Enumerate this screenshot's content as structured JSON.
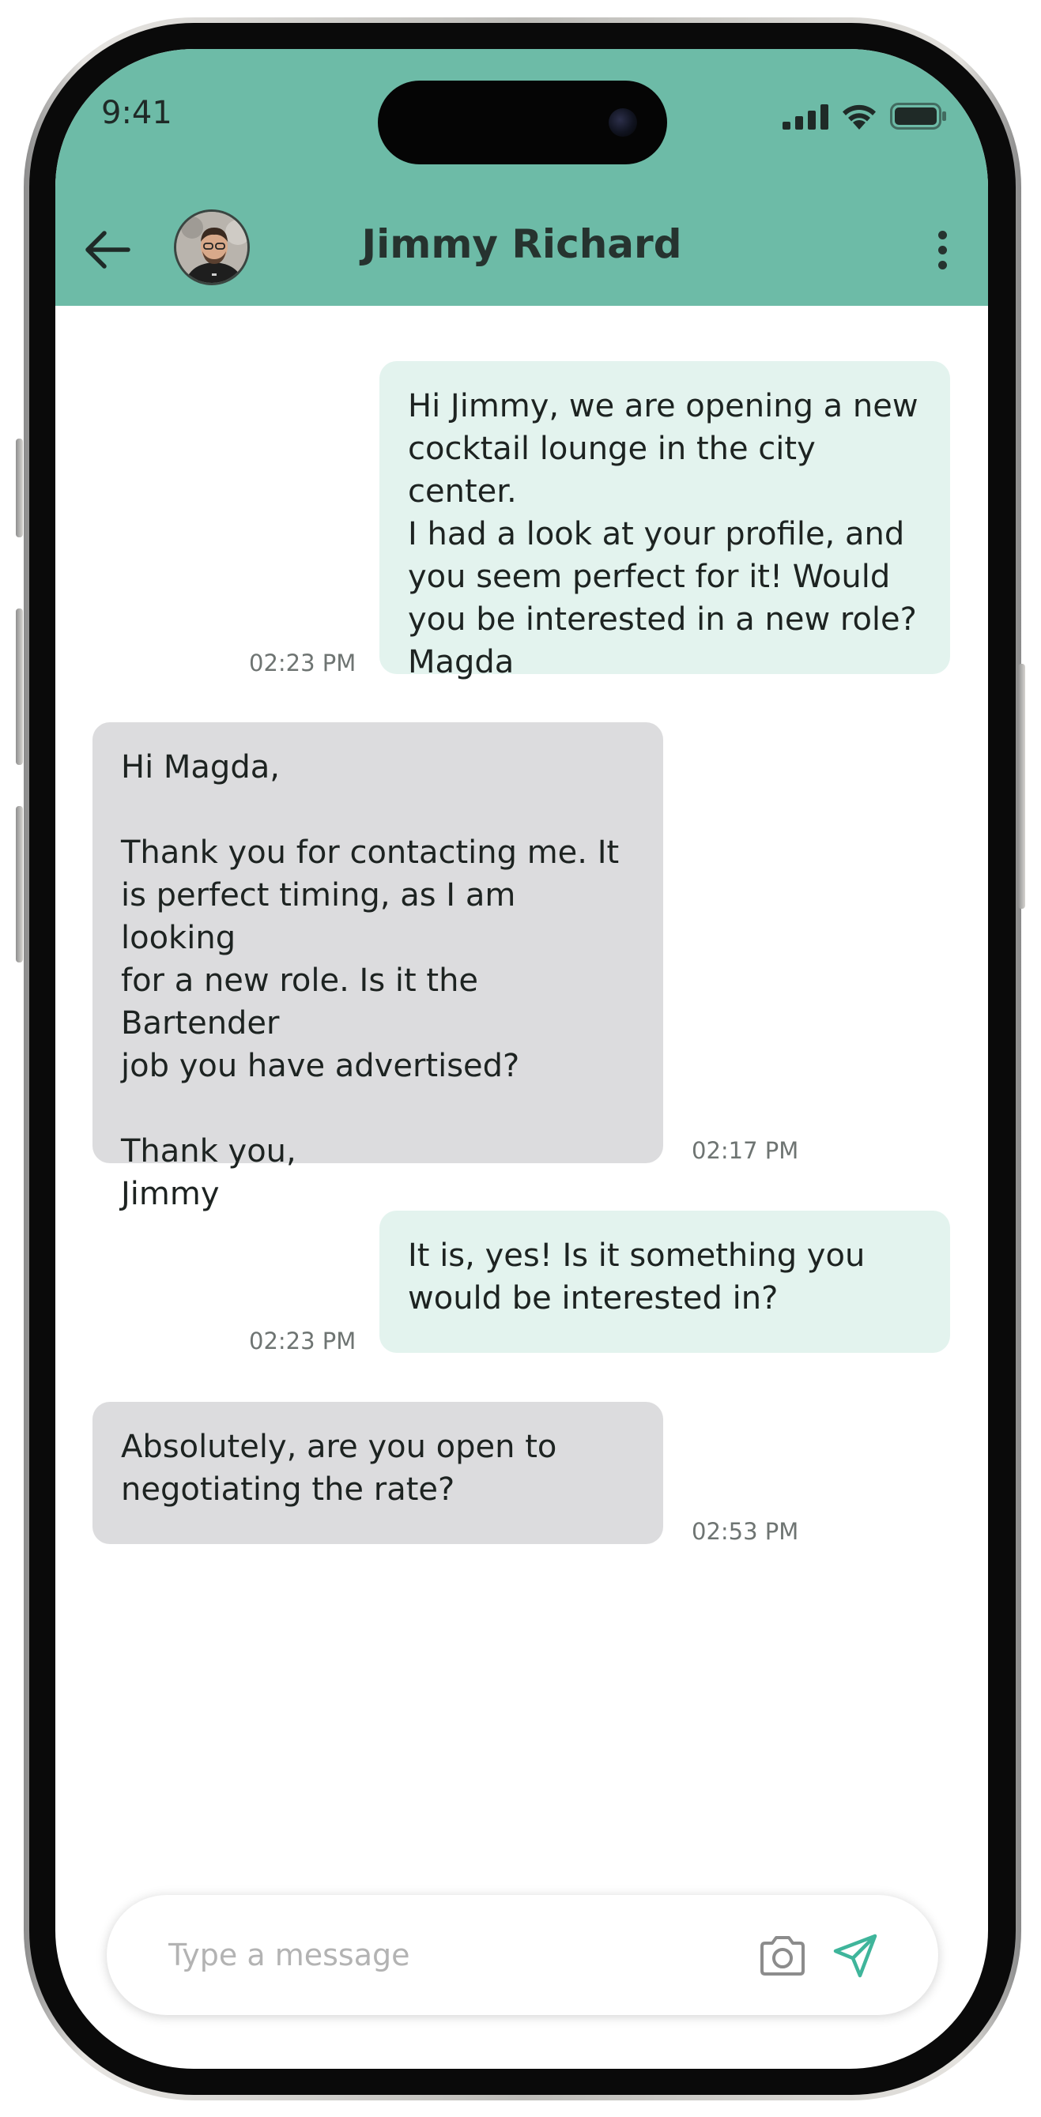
{
  "status_bar": {
    "time": "9:41"
  },
  "header": {
    "contact_name": "Jimmy Richard",
    "accent_color": "#6dbba7"
  },
  "messages": [
    {
      "direction": "outgoing",
      "text": "Hi Jimmy, we are opening a new\ncocktail lounge in the city center.\nI had a look at your profile, and\nyou seem perfect for it! Would\nyou be interested in a new role?\nMagda",
      "time": "02:23  PM"
    },
    {
      "direction": "incoming",
      "text": "Hi Magda,\n\nThank you for contacting me. It\nis perfect timing, as I am looking\nfor a new role. Is it the Bartender\njob you have advertised?\n\nThank you,\nJimmy",
      "time": "02:17  PM"
    },
    {
      "direction": "outgoing",
      "text": "It is, yes! Is it something you\nwould be interested in?",
      "time": "02:23  PM"
    },
    {
      "direction": "incoming",
      "text": "Absolutely, are you open to\nnegotiating the rate?",
      "time": "02:53  PM"
    }
  ],
  "composer": {
    "placeholder": "Type a message",
    "camera_icon": "camera-icon",
    "send_icon": "send-icon",
    "send_color": "#3fb59b"
  }
}
